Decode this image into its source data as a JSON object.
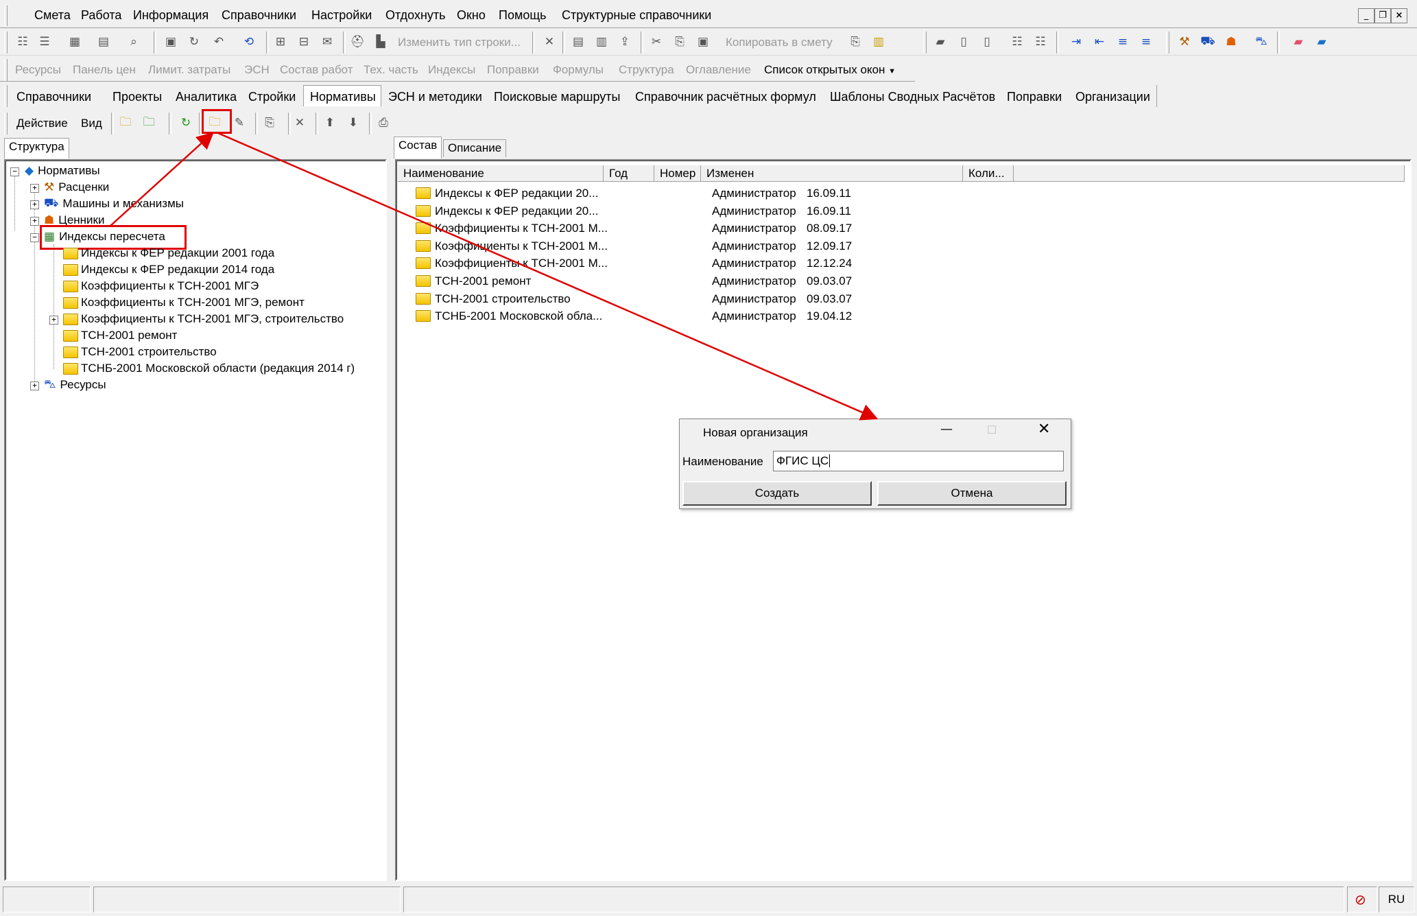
{
  "menu": {
    "items": [
      "Смета",
      "Работа",
      "Информация",
      "Справочники",
      "Настройки",
      "Отдохнуть",
      "Окно",
      "Помощь",
      "Структурные справочники"
    ]
  },
  "toolbar1": {
    "change_row_type": "Изменить тип строки...",
    "copy_to_estimate": "Копировать в смету"
  },
  "toolbar2": {
    "items": [
      "Ресурсы",
      "Панель цен",
      "Лимит. затраты",
      "ЭСН",
      "Состав работ",
      "Тех. часть",
      "Индексы",
      "Поправки",
      "Формулы",
      "Структура",
      "Оглавление"
    ],
    "open_windows": "Список открытых окон"
  },
  "tabs": {
    "items": [
      "Справочники",
      "Проекты",
      "Аналитика",
      "Стройки",
      "Нормативы",
      "ЭСН и методики",
      "Поисковые маршруты",
      "Справочник расчётных формул",
      "Шаблоны Сводных Расчётов",
      "Поправки",
      "Организации"
    ],
    "active": "Нормативы"
  },
  "actionbar": {
    "action": "Действие",
    "view": "Вид"
  },
  "left_panel": {
    "tab": "Структура",
    "tree": {
      "root": "Нормативы",
      "level1": [
        "Расценки",
        "Машины и механизмы",
        "Ценники",
        "Индексы пересчета",
        "Ресурсы"
      ],
      "children": [
        "Индексы к ФЕР редакции 2001 года",
        "Индексы к ФЕР редакции 2014 года",
        "Коэффициенты к ТСН-2001 МГЭ",
        "Коэффициенты к ТСН-2001 МГЭ, ремонт",
        "Коэффициенты к ТСН-2001 МГЭ, строительство",
        "ТСН-2001 ремонт",
        "ТСН-2001 строительство",
        "ТСНБ-2001 Московской области (редакция 2014 г)"
      ]
    }
  },
  "right_panel": {
    "tabs": [
      "Состав",
      "Описание"
    ],
    "columns": [
      "Наименование",
      "Год",
      "Номер",
      "Изменен",
      "Коли..."
    ],
    "rows": [
      {
        "name": "Индексы к ФЕР редакции 20...",
        "user": "Администратор",
        "date": "16.09.11"
      },
      {
        "name": "Индексы к ФЕР редакции 20...",
        "user": "Администратор",
        "date": "16.09.11"
      },
      {
        "name": "Коэффициенты к ТСН-2001 М...",
        "user": "Администратор",
        "date": "08.09.17"
      },
      {
        "name": "Коэффициенты к ТСН-2001 М...",
        "user": "Администратор",
        "date": "12.09.17"
      },
      {
        "name": "Коэффициенты к ТСН-2001 М...",
        "user": "Администратор",
        "date": "12.12.24"
      },
      {
        "name": "ТСН-2001 ремонт",
        "user": "Администратор",
        "date": "09.03.07"
      },
      {
        "name": "ТСН-2001 строительство",
        "user": "Администратор",
        "date": "09.03.07"
      },
      {
        "name": "ТСНБ-2001 Московской обла...",
        "user": "Администратор",
        "date": "19.04.12"
      }
    ]
  },
  "dialog": {
    "title": "Новая организация",
    "label": "Наименование",
    "value": "ФГИС ЦС",
    "create": "Создать",
    "cancel": "Отмена"
  },
  "statusbar": {
    "lang": "RU"
  },
  "colors": {
    "annotation": "#e00000",
    "folder": "#f5c400"
  }
}
